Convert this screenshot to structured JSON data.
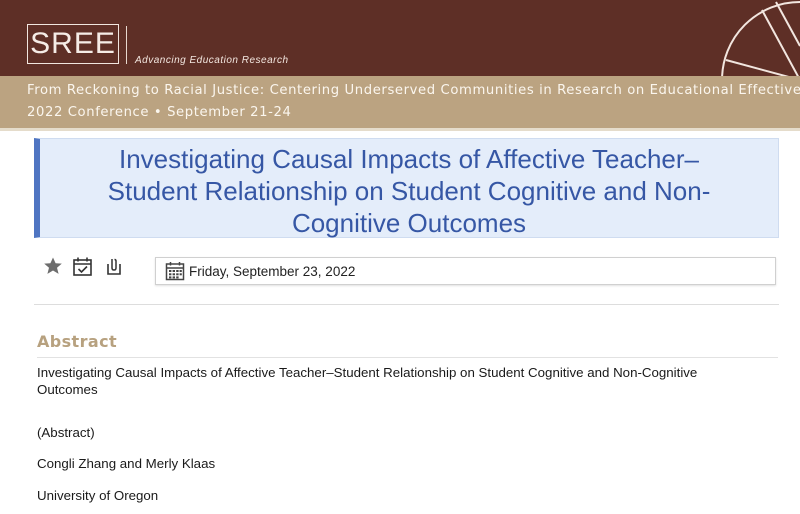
{
  "header": {
    "logo": "SREE",
    "tagline": "Advancing Education Research",
    "conference_theme": "From Reckoning to Racial Justice: Centering Underserved Communities in Research on Educational Effectiveness",
    "conference_dates": "2022 Conference • September 21-24",
    "colors": {
      "brand_dark": "#5e2f26",
      "brand_tan": "#bba381"
    }
  },
  "session": {
    "title": "Investigating Causal Impacts of Affective Teacher–Student Relationship on Student Cognitive and Non-Cognitive Outcomes",
    "date": "Friday, September 23, 2022",
    "actions": [
      {
        "name": "favorite",
        "icon": "star-icon"
      },
      {
        "name": "add-to-schedule",
        "icon": "calendar-check-icon"
      },
      {
        "name": "attachments",
        "icon": "paperclip-icon"
      }
    ],
    "accent_color": "#4f75c2"
  },
  "abstract": {
    "heading": "Abstract",
    "title": "Investigating Causal Impacts of Affective Teacher–Student Relationship on Student Cognitive and Non-Cognitive Outcomes",
    "label": "(Abstract)",
    "authors": "Congli Zhang and Merly Klaas",
    "affiliation": "University of Oregon"
  }
}
